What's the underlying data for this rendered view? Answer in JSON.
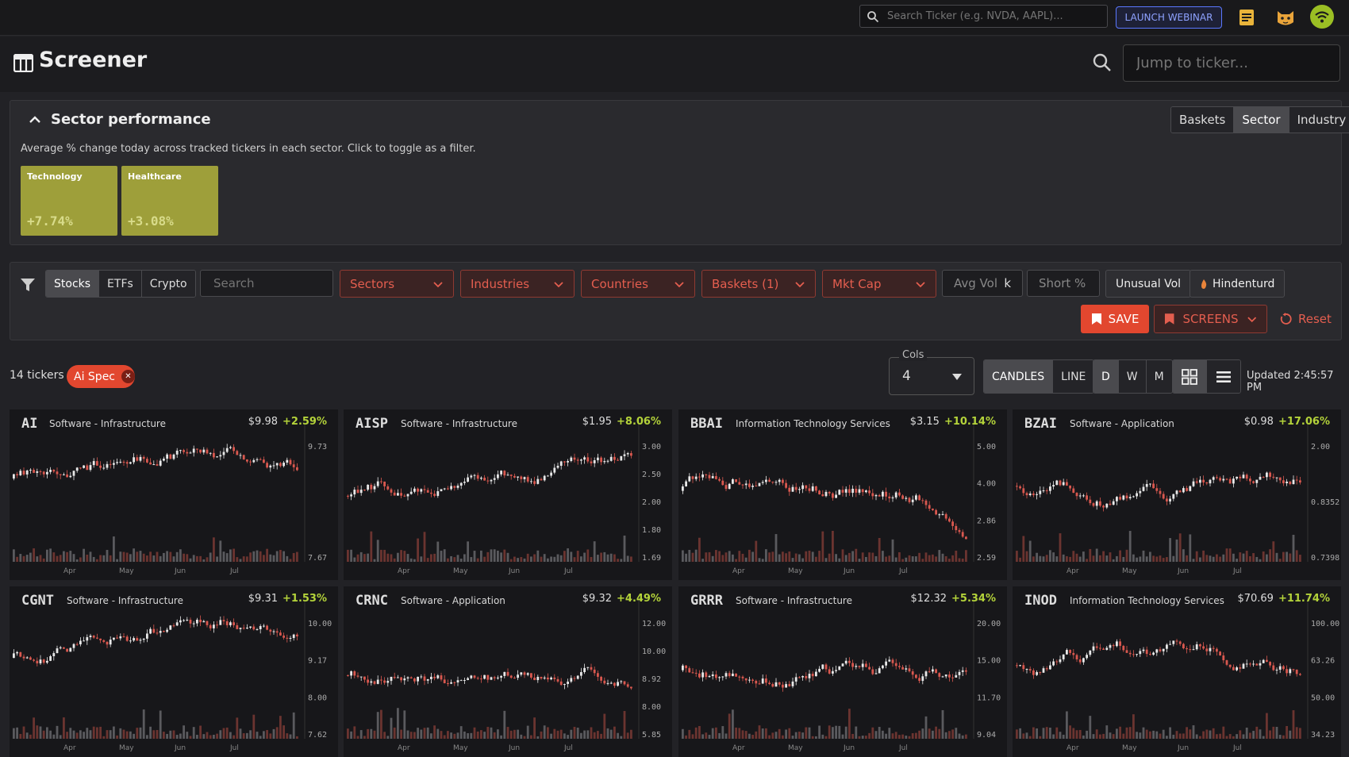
{
  "topbar": {
    "search_placeholder": "Search Ticker (e.g. NVDA, AAPL)...",
    "webinar_label": "LAUNCH WEBINAR",
    "icons": [
      "notes-icon",
      "cat-mascot-icon",
      "wifi-icon"
    ]
  },
  "header": {
    "title": "Screener",
    "jump_placeholder": "Jump to ticker..."
  },
  "sector": {
    "title": "Sector performance",
    "description": "Average % change today across tracked tickers in each sector. Click to toggle as a filter.",
    "tabs": [
      "Baskets",
      "Sector",
      "Industry"
    ],
    "active_tab": "Sector",
    "tiles": [
      {
        "name": "Technology",
        "value": "+7.74%"
      },
      {
        "name": "Healthcare",
        "value": "+3.08%"
      }
    ],
    "tile_color": "#9e9f3a"
  },
  "filters": {
    "asset_types": [
      "Stocks",
      "ETFs",
      "Crypto"
    ],
    "active_asset": "Stocks",
    "search_placeholder": "Search",
    "dropdowns": [
      "Sectors",
      "Industries",
      "Countries",
      "Baskets (1)",
      "Mkt Cap"
    ],
    "avg_vol_placeholder": "Avg Vol",
    "avg_vol_unit": "k",
    "short_placeholder": "Short %",
    "short_unit": "%",
    "unusual_vol_label": "Unusual Vol",
    "hindenturd_label": "Hindenturd",
    "save_label": "SAVE",
    "screens_label": "SCREENS",
    "reset_label": "Reset",
    "accent_color": "#e2472f"
  },
  "results": {
    "ticker_count": "14 tickers",
    "active_chip": "Ai Spec",
    "cols_label": "Cols",
    "cols_value": "4",
    "chart_types": [
      "CANDLES",
      "LINE"
    ],
    "active_chart_type": "CANDLES",
    "timeframes": [
      "D",
      "W",
      "M"
    ],
    "active_timeframe": "D",
    "view_modes": [
      "grid-view-icon",
      "list-view-icon"
    ],
    "active_view": "grid-view-icon",
    "updated": "Updated 2:45:57 PM"
  },
  "cards": [
    {
      "ticker": "AI",
      "industry": "Software - Infrastructure",
      "price": "$9.98",
      "change": "+2.59%",
      "ticks": [
        "9.73",
        "7.67"
      ],
      "months": [
        "Apr",
        "May",
        "Jun",
        "Jul"
      ]
    },
    {
      "ticker": "AISP",
      "industry": "Software - Infrastructure",
      "price": "$1.95",
      "change": "+8.06%",
      "ticks": [
        "3.00",
        "2.50",
        "2.00",
        "1.80",
        "1.69"
      ],
      "months": [
        "Apr",
        "May",
        "Jun",
        "Jul"
      ]
    },
    {
      "ticker": "BBAI",
      "industry": "Information Technology Services",
      "price": "$3.15",
      "change": "+10.14%",
      "ticks": [
        "5.00",
        "4.00",
        "2.86",
        "2.59"
      ],
      "months": [
        "Apr",
        "May",
        "Jun",
        "Jul"
      ]
    },
    {
      "ticker": "BZAI",
      "industry": "Software - Application",
      "price": "$0.98",
      "change": "+17.06%",
      "ticks": [
        "2.00",
        "0.8352",
        "0.7398"
      ],
      "months": [
        "Apr",
        "May",
        "Jun",
        "Jul"
      ]
    },
    {
      "ticker": "CGNT",
      "industry": "Software - Infrastructure",
      "price": "$9.31",
      "change": "+1.53%",
      "ticks": [
        "10.00",
        "9.17",
        "8.00",
        "7.62"
      ],
      "months": [
        "Apr",
        "May",
        "Jun",
        "Jul"
      ]
    },
    {
      "ticker": "CRNC",
      "industry": "Software - Application",
      "price": "$9.32",
      "change": "+4.49%",
      "ticks": [
        "12.00",
        "10.00",
        "8.92",
        "8.00",
        "5.85"
      ],
      "months": [
        "Apr",
        "May",
        "Jun",
        "Jul"
      ]
    },
    {
      "ticker": "GRRR",
      "industry": "Software - Infrastructure",
      "price": "$12.32",
      "change": "+5.34%",
      "ticks": [
        "20.00",
        "15.00",
        "11.70",
        "9.04"
      ],
      "months": [
        "Apr",
        "May",
        "Jun",
        "Jul"
      ]
    },
    {
      "ticker": "INOD",
      "industry": "Information Technology Services",
      "price": "$70.69",
      "change": "+11.74%",
      "ticks": [
        "100.00",
        "63.26",
        "50.00",
        "34.23"
      ],
      "months": [
        "Apr",
        "May",
        "Jun",
        "Jul"
      ]
    }
  ]
}
